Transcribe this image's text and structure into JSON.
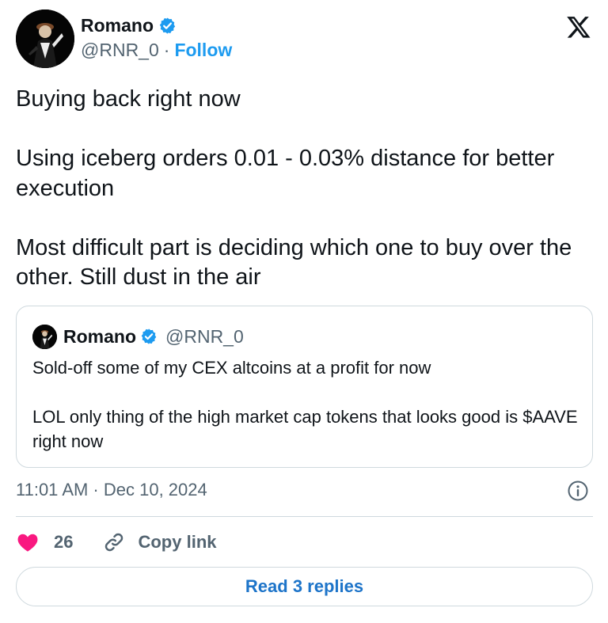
{
  "author": {
    "name": "Romano",
    "handle": "@RNR_0",
    "separator": "·",
    "follow_label": "Follow"
  },
  "tweet": {
    "text": "Buying back right now\n\nUsing  iceberg orders 0.01 - 0.03% distance for better execution\n\nMost difficult part is deciding which one to buy over the other. Still dust in the air"
  },
  "quote": {
    "name": "Romano",
    "handle": "@RNR_0",
    "text": "Sold-off some of my CEX altcoins at a profit for now\n\nLOL only thing of the high market cap tokens that looks good is $AAVE right now"
  },
  "meta": {
    "timestamp": "11:01 AM · Dec 10, 2024"
  },
  "actions": {
    "like_count": "26",
    "copy_link_label": "Copy link"
  },
  "replies_button": {
    "label": "Read 3 replies"
  },
  "colors": {
    "accent": "#1d9bf0",
    "heart": "#f91880",
    "secondary_text": "#536471",
    "border": "#cfd9de"
  },
  "icons": [
    "verified-badge-icon",
    "x-logo-icon",
    "info-icon",
    "heart-icon",
    "link-icon"
  ]
}
